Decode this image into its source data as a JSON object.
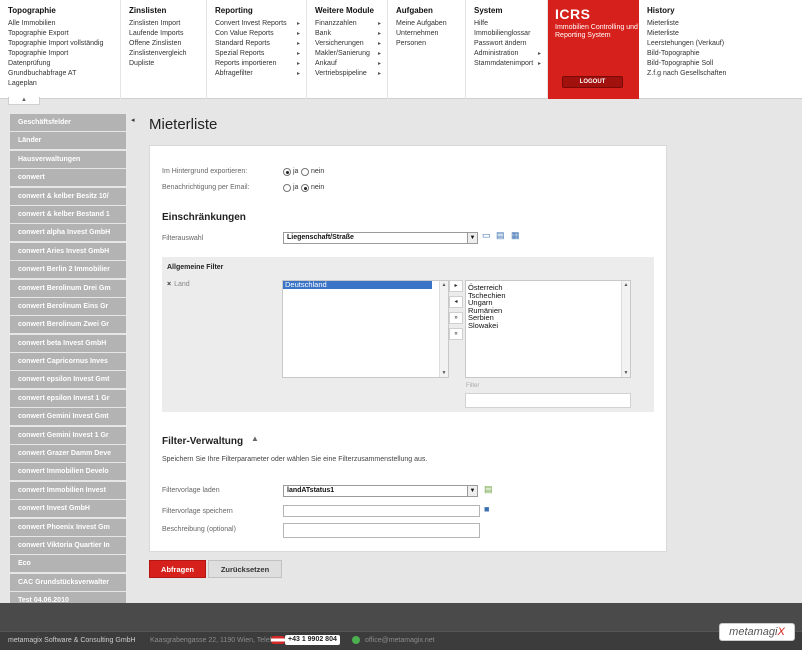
{
  "menu": [
    {
      "title": "Topographie",
      "items": [
        "Alle Immobilien",
        "Topographie Export",
        "Topographie Import vollständig",
        "Topographie Import",
        "Datenprüfung",
        "Grundbuchabfrage AT",
        "Lageplan"
      ]
    },
    {
      "title": "Zinslisten",
      "items": [
        "Zinslisten Import",
        "Laufende Imports",
        "Offene Zinslisten",
        "Zinslistenvergleich",
        "Dupliste"
      ]
    },
    {
      "title": "Reporting",
      "items": [
        "Convert Invest Reports",
        "Con Value Reports",
        "Standard Reports",
        "Spezial Reports",
        "Reports importieren",
        "Abfragefilter"
      ]
    },
    {
      "title": "Weitere Module",
      "items": [
        "Finanzzahlen",
        "Bank",
        "Versicherungen",
        "Makler/Sanierung",
        "Ankauf",
        "Vertriebspipeline"
      ]
    },
    {
      "title": "Aufgaben",
      "items": [
        "Meine Aufgaben",
        "Unternehmen",
        "Personen"
      ]
    },
    {
      "title": "System",
      "items": [
        "Hilfe",
        "Immobilienglossar",
        "Passwort ändern",
        "Administration",
        "Stammdatenimport"
      ]
    },
    {
      "title": "History",
      "items": [
        "Mieterliste",
        "Mieterliste",
        "Leerstehungen (Verkauf)",
        "Bild-Topographie",
        "Bild-Topographie Soll",
        "Z.f.g nach Gesellschaften"
      ]
    }
  ],
  "icrs": {
    "title": "ICRS",
    "subtitle": "Immobilien Controlling und Reporting System",
    "logout": "LOGOUT"
  },
  "sidebar": [
    "Geschäftsfelder",
    "Länder",
    "Hausverwaltungen",
    "conwert",
    "conwert & kelber Besitz 10/",
    "conwert & kelber Bestand 1",
    "conwert alpha Invest GmbH",
    "conwert Aries Invest GmbH",
    "conwert Berlin 2 Immobilier",
    "conwert Berolinum Drei Gm",
    "conwert Berolinum Eins Gr",
    "conwert Berolinum Zwei Gr",
    "conwert beta Invest GmbH",
    "conwert Capricornus Inves",
    "conwert epsilon Invest Gmt",
    "conwert epsilon Invest 1 Gr",
    "conwert Gemini Invest Gmt",
    "conwert Gemini Invest 1 Gr",
    "conwert Grazer Damm Deve",
    "conwert Immobilien Develo",
    "conwert Immobilien Invest",
    "conwert Invest GmbH",
    "conwert Phoenix Invest Gm",
    "conwert Viktoria Quartier In",
    "Eco",
    "CAC Grundstücksverwalter",
    "Test 04.06.2010"
  ],
  "page": {
    "title": "Mieterliste",
    "bg_export_label": "Im Hintergrund exportieren:",
    "email_label": "Benachrichtigung per Email:",
    "ja": "ja",
    "nein": "nein",
    "restrictions_heading": "Einschränkungen",
    "filter_select_label": "Filterauswahl",
    "filter_select_value": "Liegenschaft/Straße",
    "general_filter": "Allgemeine Filter",
    "land_filter": "Land",
    "selected_list": [
      "Deutschland"
    ],
    "available_list": [
      "Österreich",
      "Tschechien",
      "Ungarn",
      "Rumänien",
      "Serbien",
      "Slowakei"
    ],
    "filter_field_label": "Filter",
    "filter_mgmt_heading": "Filter-Verwaltung",
    "filter_mgmt_desc": "Speichern Sie Ihre Filterparameter oder wählen Sie eine Filterzusammenstellung aus.",
    "template_load_label": "Filtervorlage laden",
    "template_load_value": "landATstatus1",
    "template_save_label": "Filtervorlage speichern",
    "description_label": "Beschreibung (optional)",
    "btn_query": "Abfragen",
    "btn_reset": "Zurücksetzen"
  },
  "footer": {
    "company": "metamagix Software & Consulting GmbH",
    "address": "Kaasgrabengasse 22, 1190 Wien, Telefon:",
    "phone": "+43 1 9902 804",
    "email": "office@metamagix.net",
    "brand_main": "metamagi",
    "brand_x": "X"
  }
}
